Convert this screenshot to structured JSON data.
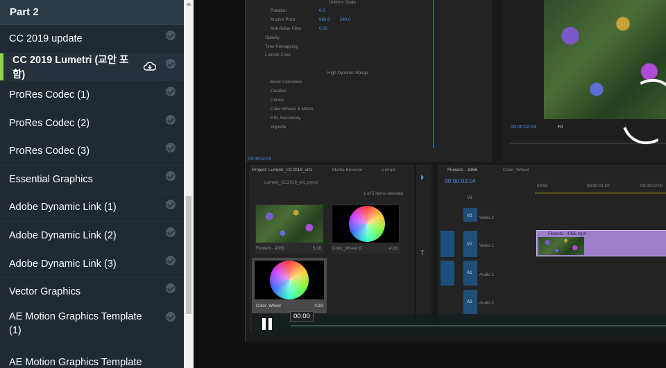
{
  "sidebar": {
    "section_title": "Part 2",
    "lessons": [
      {
        "label": "CC 2019 update"
      },
      {
        "label": "CC 2019 Lumetri (교안 포함)"
      },
      {
        "label": "ProRes Codec (1)"
      },
      {
        "label": "ProRes Codec (2)"
      },
      {
        "label": "ProRes Codec (3)"
      },
      {
        "label": "Essential Graphics"
      },
      {
        "label": "Adobe Dynamic Link (1)"
      },
      {
        "label": "Adobe Dynamic Link (2)"
      },
      {
        "label": "Adobe Dynamic Link (3)"
      },
      {
        "label": "Vector Graphics"
      },
      {
        "label": "AE Motion Graphics Template (1)"
      },
      {
        "label": "AE Motion Graphics Template"
      }
    ],
    "active_index": 1,
    "accent_color": "#8fd24c"
  },
  "video": {
    "current_time": "00:00",
    "effect_controls": {
      "rows": [
        "Uniform Scale",
        "Rotation",
        "Anchor Point",
        "Anti-flicker Filter",
        "Opacity",
        "Time Remapping",
        "Lumetri Color",
        "High Dynamic Range",
        "Basic Correction",
        "Creative",
        "Curves",
        "Color Wheels & Match",
        "HSL Secondary",
        "Vignette"
      ],
      "values": {
        "rotation": "0.0",
        "anchor_x": "960.0",
        "anchor_y": "540.0",
        "anti_flicker": "0.00"
      },
      "timecode": "00:00:02:04"
    },
    "program_monitor": {
      "timecode": "00:00:02:04",
      "fit": "Fit"
    },
    "project_panel": {
      "tab": "Project: Lumetri_CC2019_v01",
      "tabs": [
        "Media Browser",
        "Librari"
      ],
      "file": "Lumetri_CC2019_v01.prproj",
      "count": "1 of 5 items selected",
      "items": [
        {
          "name": "Flowers - 4356",
          "duration": "5:16"
        },
        {
          "name": "Color_Wheel.tif",
          "duration": "4:29"
        },
        {
          "name": "Color_Wheel",
          "duration": "4:29"
        }
      ]
    },
    "timeline": {
      "tabs": [
        "Flowers - 4356",
        "Color_Wheel"
      ],
      "timecode": "00:00:02:04",
      "ruler": [
        "00:00",
        "00:00:01:00",
        "00:00:02:00"
      ],
      "tracks": [
        "V3",
        "V2",
        "V1",
        "A1",
        "A2"
      ],
      "track_names": [
        "Video 2",
        "Video 1",
        "Audio 1",
        "Audio 2"
      ],
      "clip": "Flowers - 4356.mp4"
    }
  }
}
